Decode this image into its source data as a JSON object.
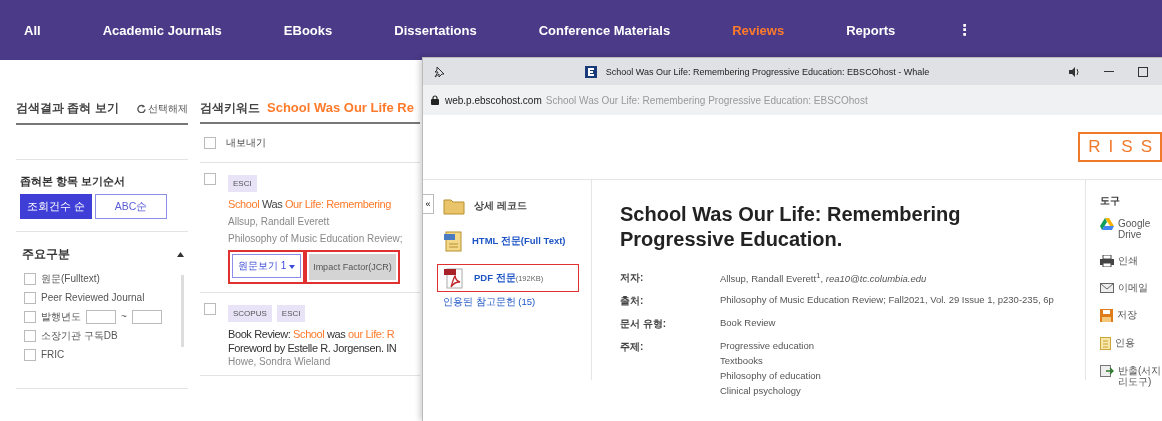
{
  "nav": {
    "tabs": [
      {
        "label": "All",
        "selected": false
      },
      {
        "label": "Academic Journals",
        "selected": false
      },
      {
        "label": "EBooks",
        "selected": false
      },
      {
        "label": "Dissertations",
        "selected": false
      },
      {
        "label": "Conference Materials",
        "selected": false
      },
      {
        "label": "Reviews",
        "selected": true
      },
      {
        "label": "Reports",
        "selected": false
      }
    ],
    "more": "⋮"
  },
  "filter_panel": {
    "title": "검색결과 좁혀 보기",
    "reset": "선택해제",
    "sort_title": "좁혀본 항목 보기순서",
    "sort_buttons": [
      {
        "label": "조회건수 순",
        "selected": true
      },
      {
        "label": "ABC순",
        "selected": false
      }
    ],
    "section": {
      "title": "주요구분",
      "expanded": true,
      "options": [
        {
          "kind": "checkbox",
          "label": "원문(Fulltext)",
          "checked": false
        },
        {
          "kind": "checkbox",
          "label": "Peer Reviewed Journal",
          "checked": false
        },
        {
          "kind": "year",
          "label": "발행년도",
          "checked": false,
          "separator": "~"
        },
        {
          "kind": "checkbox",
          "label": "소장기관 구독DB",
          "checked": false
        },
        {
          "kind": "checkbox",
          "label": "FRIC",
          "checked": false
        }
      ]
    }
  },
  "results": {
    "keyword_label": "검색키워드",
    "keyword": "School Was Our Life Re",
    "export": {
      "label": "내보내기",
      "checked": false
    },
    "items": [
      {
        "checked": false,
        "badges": [
          "ESCI"
        ],
        "title_lines": [
          [
            {
              "text": "School",
              "hl": true
            },
            {
              "text": " Was ",
              "hl": false
            },
            {
              "text": "Our Life: Remembering",
              "hl": true
            }
          ]
        ],
        "author": "Allsup, Randall Everett",
        "source": "Philosophy of Music Education Review;",
        "buttons": [
          {
            "kind": "fulltext",
            "label": "원문보기 1",
            "annotated": true
          },
          {
            "kind": "impact",
            "label": "Impact Factor(JCR)",
            "annotated": true
          }
        ]
      },
      {
        "checked": false,
        "badges": [
          "SCOPUS",
          "ESCI"
        ],
        "title_lines": [
          [
            {
              "text": "Book Review: ",
              "hl": false
            },
            {
              "text": "School",
              "hl": true
            },
            {
              "text": " was ",
              "hl": false
            },
            {
              "text": "our Life: R",
              "hl": true
            }
          ],
          [
            {
              "text": "Foreword by Estelle R. Jorgensen. IN",
              "hl": false
            }
          ]
        ],
        "author": "Howe, Sondra Wieland"
      }
    ]
  },
  "popup": {
    "window_title": "School Was Our Life: Remembering Progressive Education: EBSCOhost - Whale",
    "address_domain": "web.p.ebscohost.com",
    "address_rest": "School Was Our Life: Remembering Progressive Education: EBSCOhost",
    "logo": "RISS",
    "collapse": "«",
    "sidebar": [
      {
        "kind": "folder",
        "label": "상세 레코드",
        "annotated": false
      },
      {
        "kind": "html",
        "label": "HTML 전문(Full Text)",
        "annotated": false
      },
      {
        "kind": "pdf",
        "label": "PDF 전문",
        "size": "(192KB)",
        "annotated": true
      },
      {
        "kind": "link",
        "label": "인용된 참고문헌 (15)",
        "annotated": false
      }
    ],
    "article_title": "School Was Our Life: Remembering Progressive Education.",
    "fields": [
      {
        "label": "저자:",
        "values": [
          "Allsup, Randall Everett$^{1}$, *rea10@tc.columbia.edu*"
        ]
      },
      {
        "label": "출처:",
        "values": [
          "Philosophy of Music Education Review; Fall2021, Vol. 29 Issue 1, p230-235, 6p"
        ]
      },
      {
        "label": "문서 유형:",
        "values": [
          "Book Review"
        ]
      },
      {
        "label": "주제:",
        "values": [
          "Progressive education",
          "Textbooks",
          "Philosophy of education",
          "Clinical psychology"
        ]
      }
    ],
    "tools_title": "도구",
    "tools": [
      {
        "kind": "drive",
        "label": "Google Drive"
      },
      {
        "kind": "print",
        "label": "인쇄"
      },
      {
        "kind": "email",
        "label": "이메일"
      },
      {
        "kind": "save",
        "label": "저장"
      },
      {
        "kind": "cite",
        "label": "인용"
      },
      {
        "kind": "export",
        "label": "반출(서지 리도구)"
      }
    ]
  }
}
